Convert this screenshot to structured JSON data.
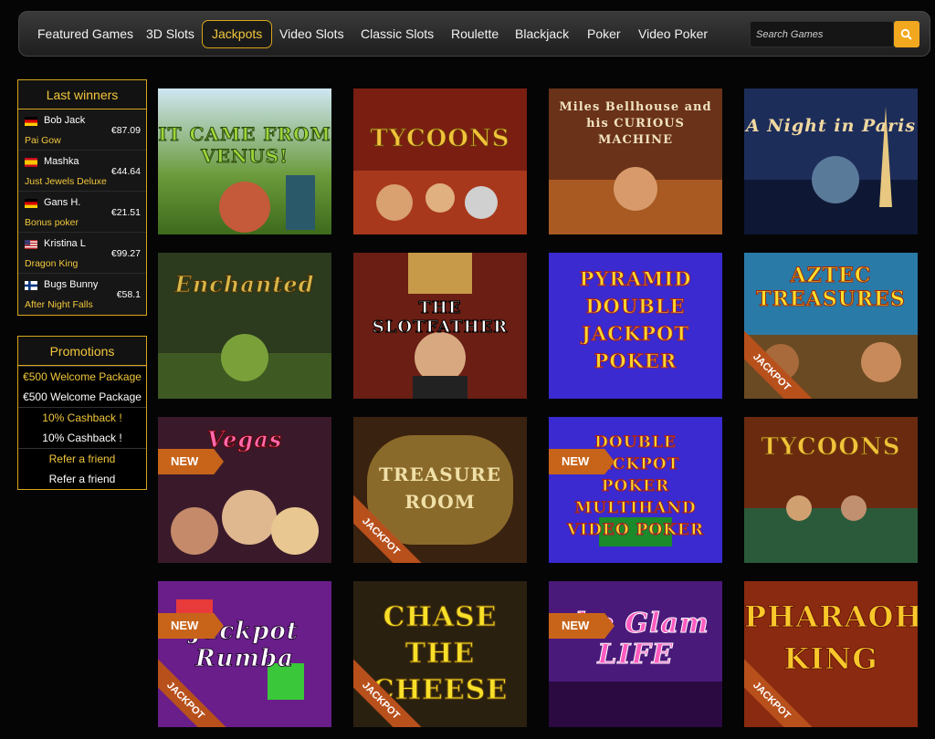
{
  "nav": {
    "items": [
      {
        "label": "Featured Games"
      },
      {
        "label": "3D Slots"
      },
      {
        "label": "Jackpots",
        "active": true
      },
      {
        "label": "Video Slots"
      },
      {
        "label": "Classic Slots"
      },
      {
        "label": "Roulette"
      },
      {
        "label": "Blackjack"
      },
      {
        "label": "Poker"
      },
      {
        "label": "Video Poker"
      }
    ],
    "search_placeholder": "Search Games",
    "search_icon": "search-icon"
  },
  "colors": {
    "accent": "#f3c83c",
    "border_gold": "#d6a51b",
    "search_button": "#f2a81e",
    "badge_orange": "#c8641a"
  },
  "last_winners": {
    "title": "Last winners",
    "entries": [
      {
        "name": "Bob Jack",
        "amount": "€87.09",
        "game": "Pai Gow",
        "flag": "germany-flag-icon"
      },
      {
        "name": "Mashka",
        "amount": "€44.64",
        "game": "Just Jewels Deluxe",
        "flag": "spain-flag-icon"
      },
      {
        "name": "Gans H.",
        "amount": "€21.51",
        "game": "Bonus poker",
        "flag": "germany-flag-icon"
      },
      {
        "name": "Kristina L",
        "amount": "€99.27",
        "game": "Dragon King",
        "flag": "usa-flag-icon"
      },
      {
        "name": "Bugs Bunny",
        "amount": "€58.1",
        "game": "After Night Falls",
        "flag": "finland-flag-icon"
      }
    ]
  },
  "promotions": {
    "title": "Promotions",
    "items": [
      {
        "text": "€500 Welcome Package",
        "style": "gold"
      },
      {
        "text": "€500 Welcome Package",
        "style": "white"
      },
      {
        "text": "10% Cashback !",
        "style": "gold"
      },
      {
        "text": "10% Cashback !",
        "style": "white"
      },
      {
        "text": "Refer a friend",
        "style": "gold"
      },
      {
        "text": "Refer a friend",
        "style": "white"
      }
    ]
  },
  "badges": {
    "new": "NEW",
    "jackpot": "JACKPOT"
  },
  "games": [
    {
      "title": "IT CAME FROM VENUS!"
    },
    {
      "title": "TYCOONS"
    },
    {
      "title": "Miles Bellhouse and his CURIOUS MACHINE"
    },
    {
      "title": "A Night in Paris"
    },
    {
      "title": "Enchanted"
    },
    {
      "title": "THE SLOTFATHER"
    },
    {
      "title": "PYRAMID DOUBLE JACKPOT POKER"
    },
    {
      "title": "AZTEC TREASURES",
      "jackpot": true
    },
    {
      "title": "Vegas",
      "new": true
    },
    {
      "title": "TREASURE ROOM",
      "jackpot": true
    },
    {
      "title": "DOUBLE JACKPOT POKER MULTIHAND VIDEO POKER",
      "new": true
    },
    {
      "title": "TYCOONS"
    },
    {
      "title": "Jackpot Rumba",
      "new": true,
      "jackpot": true
    },
    {
      "title": "CHASE THE CHEESE",
      "jackpot": true
    },
    {
      "title": "the Glam LIFE",
      "new": true
    },
    {
      "title": "PHARAOH KING",
      "jackpot": true
    }
  ]
}
